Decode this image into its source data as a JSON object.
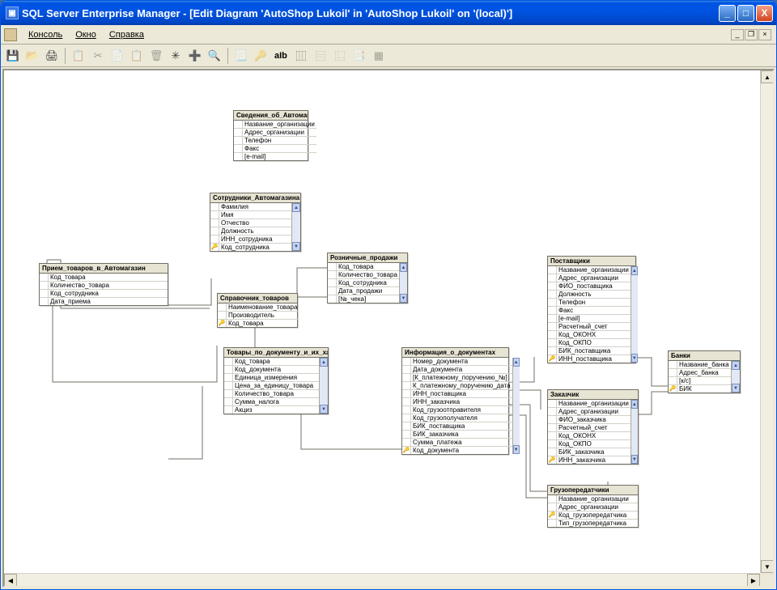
{
  "window": {
    "title": "SQL Server Enterprise Manager - [Edit Diagram 'AutoShop Lukoil' in 'AutoShop Lukoil' on '(local)']",
    "min": "_",
    "max": "□",
    "close": "X"
  },
  "menu": {
    "console": "Консоль",
    "window": "Окно",
    "help": "Справка"
  },
  "mdi": {
    "min": "_",
    "restore": "❐",
    "close": "×"
  },
  "tool": {
    "save": "💾",
    "open": "📂",
    "print": "🖨",
    "prop": "📋",
    "cut": "✂",
    "copy": "📄",
    "paste": "📋",
    "del": "🗑",
    "new": "✳",
    "add": "➕",
    "zoom": "🔍",
    "page": "📃",
    "key": "🔑",
    "ab": "aIb",
    "schema": "⿲",
    "arrange": "⿳",
    "align": "⿺",
    "key2": "📑",
    "grid": "▦"
  },
  "e_svedenia": {
    "title": "Сведения_об_Автомага",
    "r0": "Название_организации",
    "r1": "Адрес_организации",
    "r2": "Телефон",
    "r3": "Факс",
    "r4": "[e-mail]"
  },
  "e_sotrudniki": {
    "title": "Сотрудники_Автомагазина",
    "r0": "Фамилия",
    "r1": "Имя",
    "r2": "Отчество",
    "r3": "Должность",
    "r4": "ИНН_сотрудника",
    "r5": "Код_сотрудника"
  },
  "e_priem": {
    "title": "Прием_товаров_в_Автомагазин",
    "r0": "Код_товара",
    "r1": "Количество_товара",
    "r2": "Код_сотрудника",
    "r3": "Дата_приема"
  },
  "e_sprav": {
    "title": "Справочник_товаров",
    "r0": "Наименование_товара",
    "r1": "Производитель",
    "r2": "Код_товара"
  },
  "e_rozn": {
    "title": "Розничные_продажи",
    "r0": "Код_товара",
    "r1": "Количество_товара",
    "r2": "Код_сотрудника",
    "r3": "Дата_продажи",
    "r4": "[№_чека]"
  },
  "e_tovary_doc": {
    "title": "Товары_по_документу_и_их_хар",
    "r0": "Код_товара",
    "r1": "Код_документа",
    "r2": "Единица_измерения",
    "r3": "Цена_за_единицу_товара",
    "r4": "Количество_товара",
    "r5": "Сумма_налога",
    "r6": "Акциз"
  },
  "e_info_doc": {
    "title": "Информация_о_документах",
    "r0": "Номер_документа",
    "r1": "Дата_документа",
    "r2": "[К_платежному_поручению_№]",
    "r3": "К_платежному_поручению_дата",
    "r4": "ИНН_поставщика",
    "r5": "ИНН_заказчика",
    "r6": "Код_грузоотправителя",
    "r7": "Код_грузополучателя",
    "r8": "БИК_поставщика",
    "r9": "БИК_заказчика",
    "r10": "Сумма_платежа",
    "r11": "Код_документа"
  },
  "e_post": {
    "title": "Поставщики",
    "r0": "Название_организации",
    "r1": "Адрес_организации",
    "r2": "ФИО_поставщика",
    "r3": "Должность",
    "r4": "Телефон",
    "r5": "Факс",
    "r6": "[e-mail]",
    "r7": "Расчетный_счет",
    "r8": "Код_ОКОНХ",
    "r9": "Код_ОКПО",
    "r10": "БИК_поставщика",
    "r11": "ИНН_поставщика"
  },
  "e_banki": {
    "title": "Банки",
    "r0": "Название_банка",
    "r1": "Адрес_банка",
    "r2": "[к/c]",
    "r3": "БИК"
  },
  "e_zakaz": {
    "title": "Заказчик",
    "r0": "Название_организации",
    "r1": "Адрес_организации",
    "r2": "ФИО_заказчика",
    "r3": "Расчетный_счет",
    "r4": "Код_ОКОНХ",
    "r5": "Код_ОКПО",
    "r6": "БИК_заказчика",
    "r7": "ИНН_заказчика"
  },
  "e_gruz": {
    "title": "Грузопередатчики",
    "r0": "Название_организации",
    "r1": "Адрес_организации",
    "r2": "Код_грузопередатчика",
    "r3": "Тип_грузопередатчика"
  }
}
